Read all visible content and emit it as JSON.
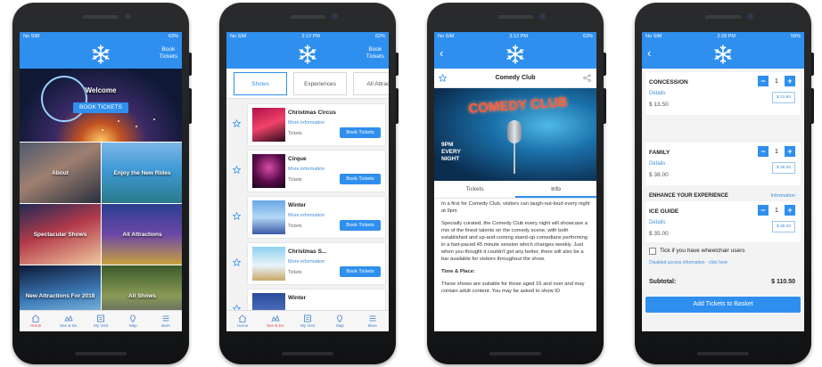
{
  "status": {
    "p1": {
      "carrier": "No SIM",
      "time": "",
      "battery": "63%"
    },
    "p2": {
      "carrier": "No SIM",
      "time": "3:12 PM",
      "battery": "62%"
    },
    "p3": {
      "carrier": "No SIM",
      "time": "3:12 PM",
      "battery": "63%"
    },
    "p4": {
      "carrier": "No SIM",
      "time": "3:28 PM",
      "battery": "59%"
    }
  },
  "header": {
    "book_line1": "Book",
    "book_line2": "Tickets",
    "back_glyph": "‹"
  },
  "home": {
    "hero_title": "Welcome",
    "hero_cta": "BOOK TICKETS",
    "tiles": [
      "About",
      "Enjoy the New Rides",
      "Spectacular Shows",
      "All Attractions",
      "New Attractions For 2018",
      "All Shows"
    ]
  },
  "tabbar": {
    "items": [
      "Home",
      "See & Do",
      "My Visit",
      "Map",
      "More"
    ]
  },
  "shows_page": {
    "categories": [
      "Shows",
      "Experiences",
      "All Attracti"
    ],
    "more_label": "More information",
    "tickets_label": "Tickets",
    "book_label": "Book Tickets",
    "items": [
      {
        "name": "Christmas Circus"
      },
      {
        "name": "Cirque"
      },
      {
        "name": "Winter"
      },
      {
        "name": "Christmas S..."
      },
      {
        "name": "Winter"
      }
    ]
  },
  "detail": {
    "title": "Comedy Club",
    "poster_sign": "COMEDY CLUB",
    "poster_line1": "9PM",
    "poster_line2": "EVERY",
    "poster_line3": "NIGHT",
    "tabs": [
      "Tickets",
      "Info"
    ],
    "para1": "In a first for Comedy Club, visitors can laugh-out-loud every night at 9pm",
    "para2": "Specially curated, the Comedy Club every night will showcase a mix of the finest talents on the comedy scene, with both established and up-and-coming stand-up comedians performing in a fast-paced 45 minute session which changes weekly. Just when you thought it couldn't get any better, there will also be a bar available for visitors throughout the show.",
    "heading": "Time & Place:",
    "para3": "These shows are suitable for those aged 16 and over and may contain adult content. You may be asked to show ID"
  },
  "cart": {
    "details_label": "Details",
    "items": [
      {
        "name": "CONCESSION",
        "price": "$ 13.50",
        "qty": "1",
        "subtotal": "$ 13.50"
      },
      {
        "name": "FAMILY",
        "price": "$ 38.00",
        "qty": "1",
        "subtotal": "$ 38.00"
      },
      {
        "name": "ICE GUIDE",
        "price": "$ 35.00",
        "qty": "1",
        "subtotal": "$ 35.00"
      }
    ],
    "enhance_label": "ENHANCE YOUR EXPERIENCE",
    "info_label": "Information",
    "wheelchair_label": "Tick if you have wheelchair users",
    "disabled_link": "Disabled access information - click here",
    "subtotal_label": "Subtotal:",
    "subtotal_value": "$ 110.50",
    "basket_label": "Add Tickets to Basket",
    "minus": "−",
    "plus": "+"
  },
  "colors": {
    "primary": "#2f8fef",
    "link": "#3f8ed8",
    "tab_active": "#e8464b"
  }
}
